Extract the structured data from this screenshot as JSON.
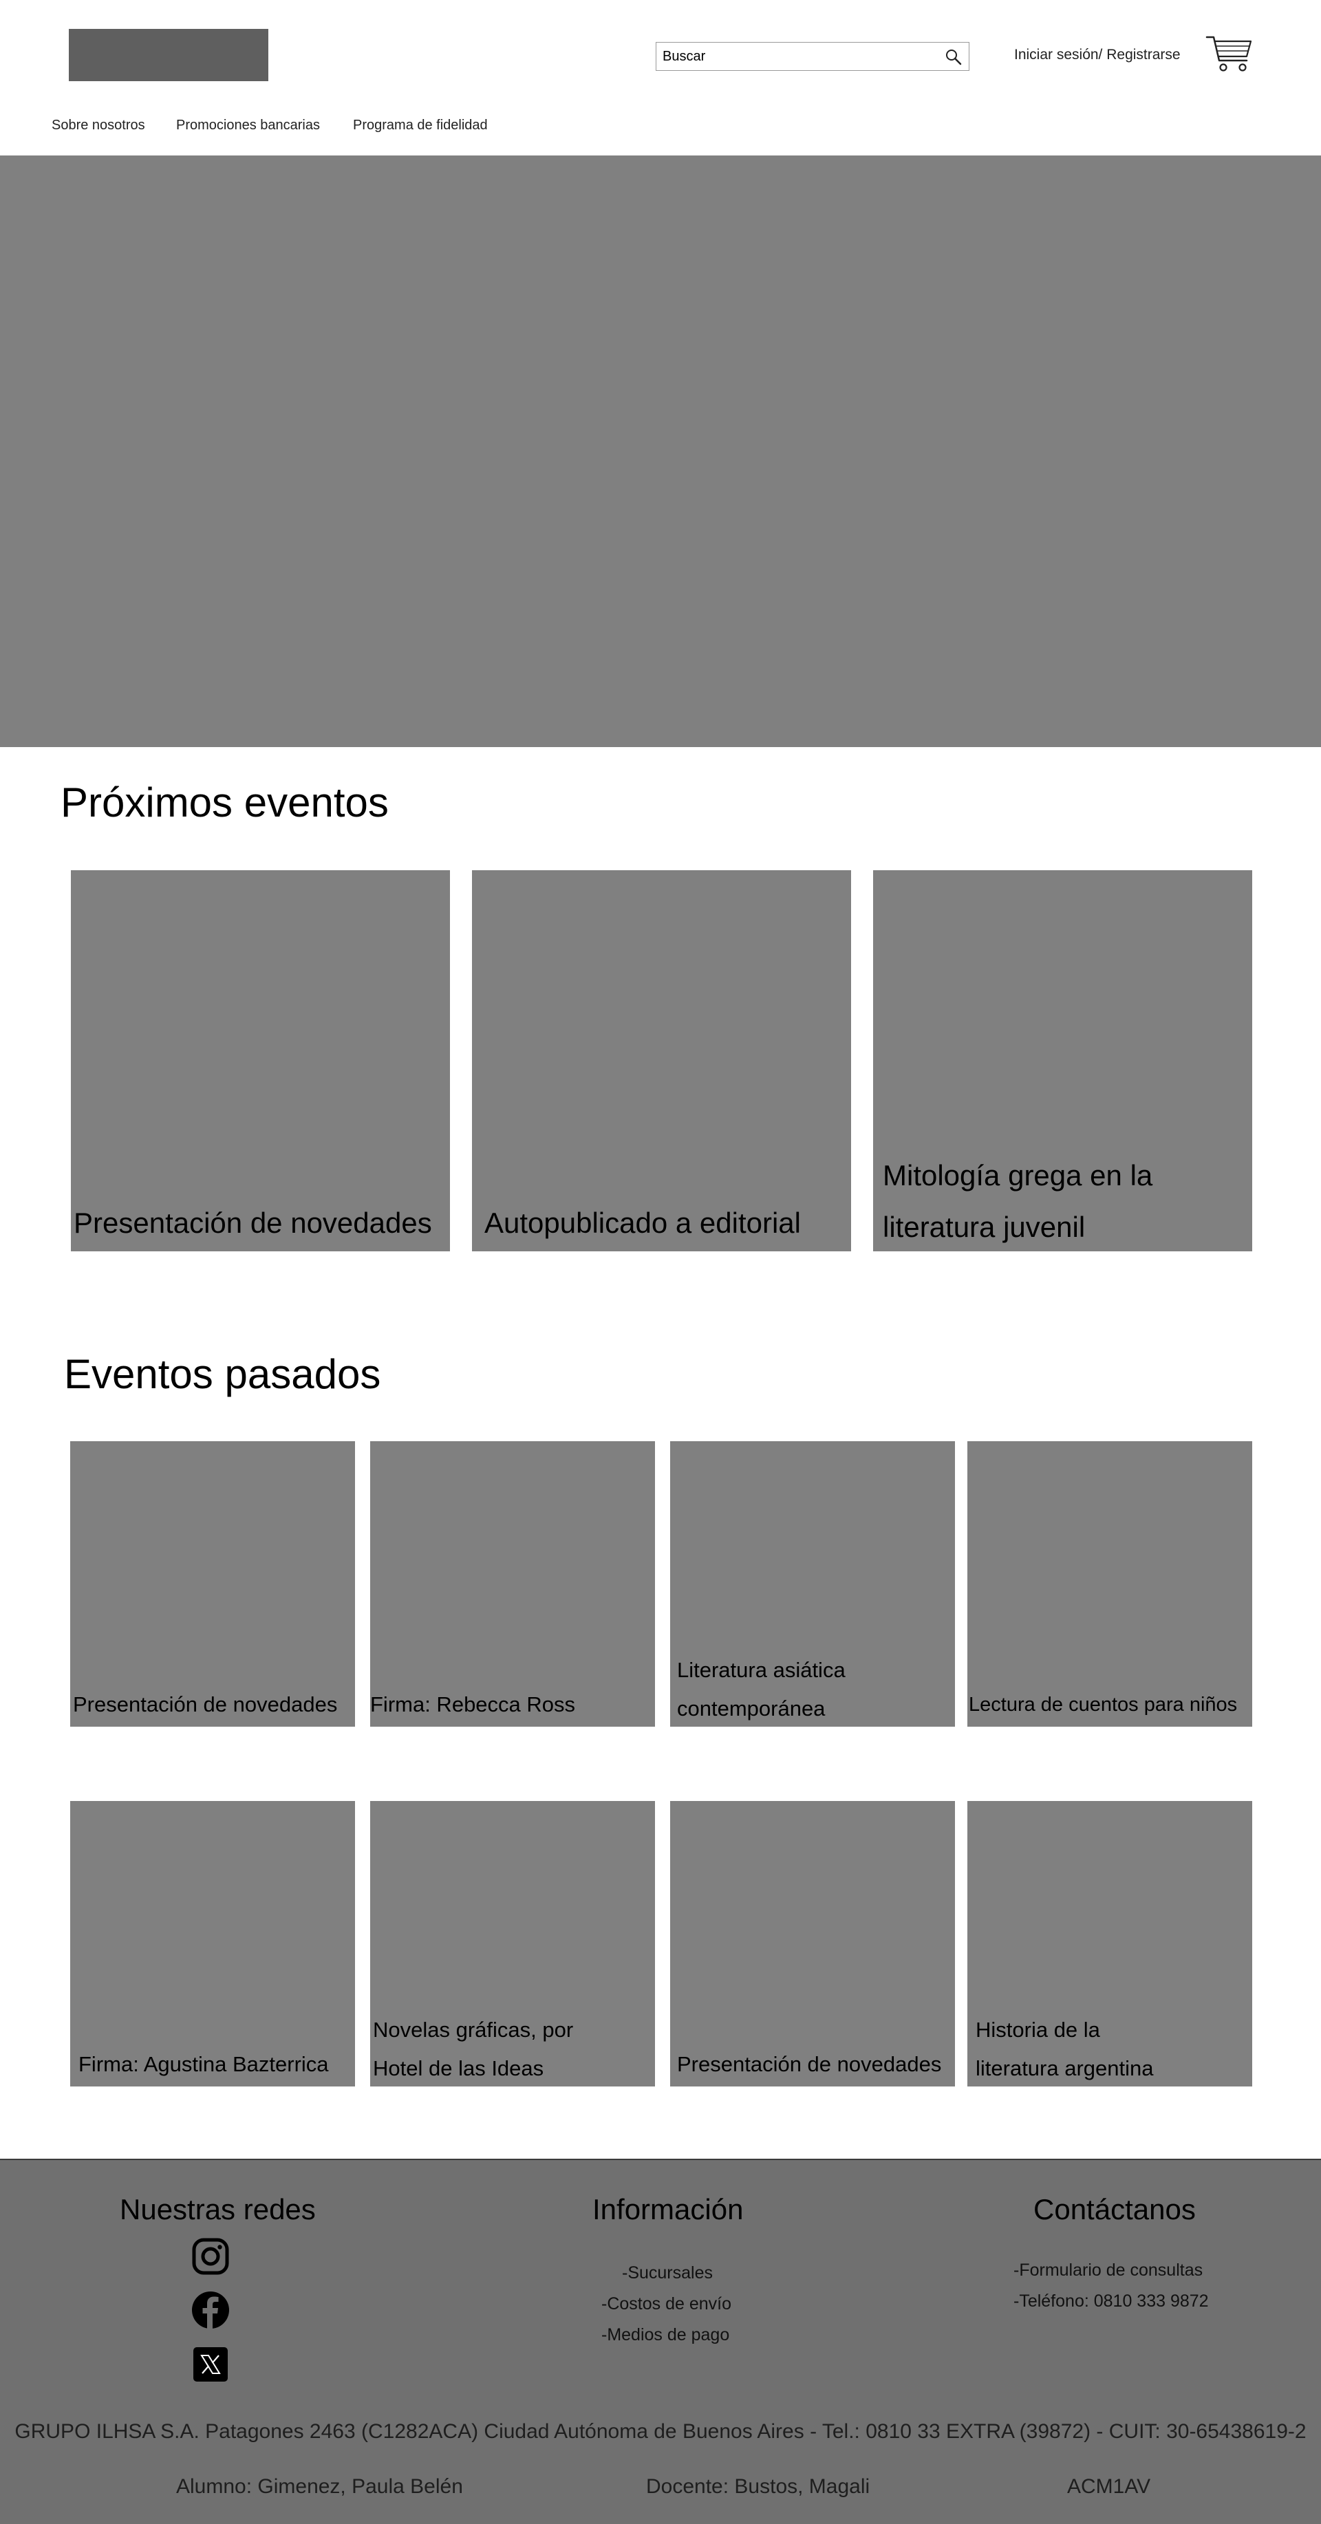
{
  "header": {
    "search_placeholder": "Buscar",
    "login_label": "Iniciar sesión/ Registrarse"
  },
  "nav": {
    "items": [
      "Sobre nosotros",
      "Promociones bancarias",
      "Programa de fidelidad"
    ]
  },
  "upcoming": {
    "title": "Próximos eventos",
    "events": [
      "Presentación de novedades",
      "Autopublicado a editorial",
      "Mitología gregа en la literatura juvenil"
    ]
  },
  "past": {
    "title": "Eventos pasados",
    "events": [
      "Presentación de novedades",
      "Firma: Rebecca Ross",
      "Literatura asiática contemporánea",
      "Lectura de cuentos para niños",
      "Firma: Agustina Bazterrica",
      "Novelas gráficas, por Hotel de las Ideas",
      "Presentación de novedades",
      "Historia de la literatura argentina"
    ]
  },
  "footer": {
    "socials_title": "Nuestras redes",
    "socials": [
      "instagram-icon",
      "facebook-icon",
      "x-icon"
    ],
    "info_title": "Información",
    "info_links": [
      "-Sucursales",
      "-Costos de envío",
      "-Medios de pago"
    ],
    "contact_title": "Contáctanos",
    "contact_links": [
      "-Formulario de consultas",
      "-Teléfono: 0810 333 9872"
    ],
    "legal": "GRUPO ILHSA S.A. Patagones 2463 (C1282ACA) Ciudad Autónoma de Buenos Aires - Tel.: 0810 33 EXTRA (39872) - CUIT: 30-65438619-2",
    "student": "Alumno: Gimenez, Paula Belén",
    "teacher": "Docente: Bustos, Magali",
    "course": "ACM1AV"
  },
  "colors": {
    "placeholder_gray": "#808080",
    "logo_gray": "#5f5f5f",
    "footer_gray": "#707070"
  }
}
